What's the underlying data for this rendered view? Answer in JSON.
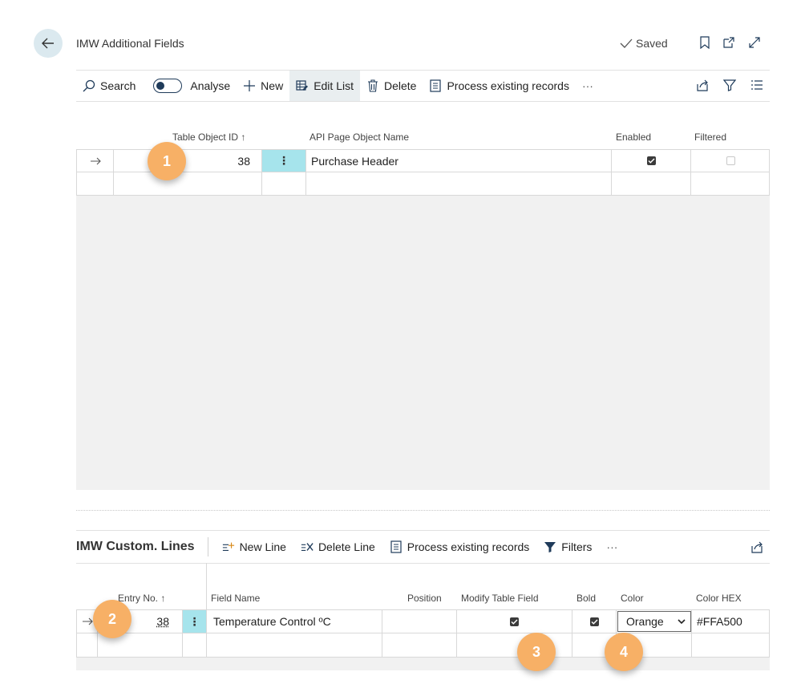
{
  "header": {
    "title": "IMW Additional Fields",
    "status": "Saved"
  },
  "toolbar": {
    "search": "Search",
    "analyse": "Analyse",
    "new": "New",
    "edit_list": "Edit List",
    "delete": "Delete",
    "process": "Process existing records",
    "more": "···"
  },
  "main_grid": {
    "columns": {
      "table_object_id": "Table Object ID ↑",
      "api_page_object_name": "API Page Object Name",
      "enabled": "Enabled",
      "filtered": "Filtered"
    },
    "rows": [
      {
        "table_object_id": "38",
        "api_page_object_name": "Purchase Header",
        "enabled": true,
        "filtered": false
      }
    ]
  },
  "lines": {
    "title": "IMW Custom. Lines",
    "toolbar": {
      "new_line": "New Line",
      "delete_line": "Delete Line",
      "process": "Process existing records",
      "filters": "Filters",
      "more": "···"
    },
    "columns": {
      "entry_no": "Entry No. ↑",
      "field_name": "Field Name",
      "position": "Position",
      "modify_table_field": "Modify Table Field",
      "bold": "Bold",
      "color": "Color",
      "color_hex": "Color HEX"
    },
    "rows": [
      {
        "entry_no": "38",
        "field_name": "Temperature Control ºC",
        "position": "",
        "modify_table_field": true,
        "bold": true,
        "color": "Orange",
        "color_hex": "#FFA500"
      }
    ]
  },
  "badges": [
    "1",
    "2",
    "3",
    "4"
  ],
  "colors": {
    "accent_cell": "#a6e4ec",
    "badge": "#f7b066",
    "back_button": "#dbe9ef"
  }
}
